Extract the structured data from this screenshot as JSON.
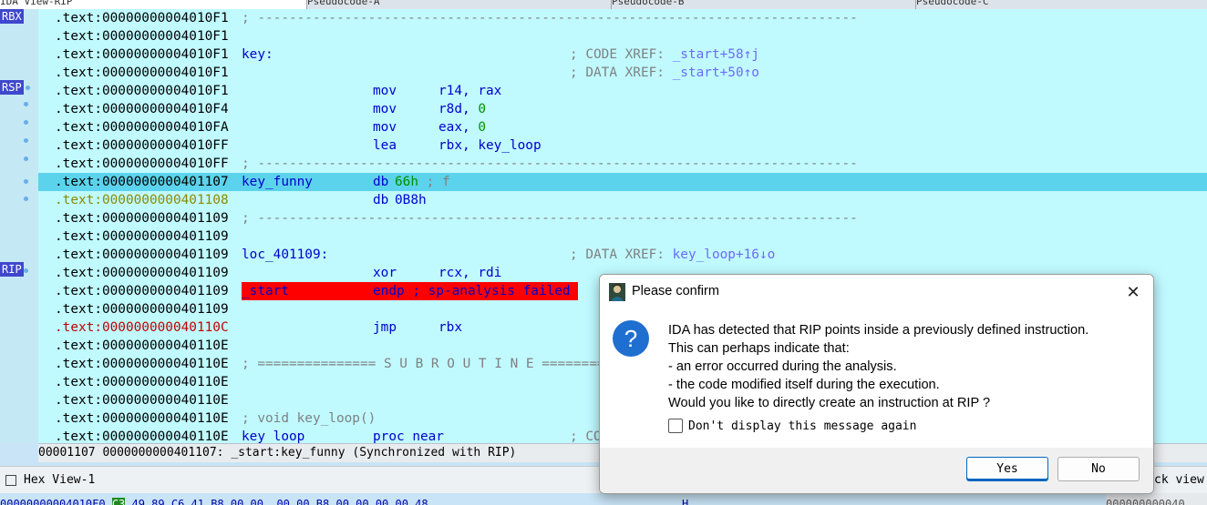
{
  "tabs": [
    {
      "label": "IDA View-RIP",
      "active": true
    },
    {
      "label": "Pseudocode-A",
      "active": false
    },
    {
      "label": "Pseudocode-B",
      "active": false
    },
    {
      "label": "Pseudocode-C",
      "active": false
    }
  ],
  "registers": [
    {
      "name": "RBX"
    },
    {
      "name": "RSP"
    },
    {
      "name": "RIP"
    }
  ],
  "listing": [
    {
      "addr": ".text:00000000004010F1",
      "sep": "; ----------------------------------------------------------------------------"
    },
    {
      "addr": ".text:00000000004010F1"
    },
    {
      "addr": ".text:00000000004010F1",
      "label": "key:",
      "comment": "; CODE XREF: ",
      "xref": "_start+58↑j"
    },
    {
      "addr": ".text:00000000004010F1",
      "comment": "; DATA XREF: ",
      "xref": "_start+50↑o"
    },
    {
      "addr": ".text:00000000004010F1",
      "mnem": "mov",
      "op1": "r14, rax"
    },
    {
      "addr": ".text:00000000004010F4",
      "mnem": "mov",
      "op1": "r8d, ",
      "num": "0"
    },
    {
      "addr": ".text:00000000004010FA",
      "mnem": "mov",
      "op1": "eax, ",
      "num": "0"
    },
    {
      "addr": ".text:00000000004010FF",
      "mnem": "lea",
      "op1": "rbx, key_loop"
    },
    {
      "addr": ".text:00000000004010FF",
      "sep": "; ----------------------------------------------------------------------------"
    },
    {
      "addr": ".text:0000000000401107",
      "label": "key_funny",
      "mnem": "db",
      "dbval": "66h",
      "dbcmt": " ; f"
    },
    {
      "addr": ".text:0000000000401108",
      "mnem": "db",
      "dbplain": "0B8h"
    },
    {
      "addr": ".text:0000000000401109",
      "sep": "; ----------------------------------------------------------------------------"
    },
    {
      "addr": ".text:0000000000401109"
    },
    {
      "addr": ".text:0000000000401109",
      "label": "loc_401109:",
      "comment": "; DATA XREF: ",
      "xref": "key_loop+16↓o"
    },
    {
      "addr": ".text:0000000000401109",
      "mnem": "xor",
      "op1": "rcx, rdi"
    },
    {
      "addr": ".text:0000000000401109",
      "label": "_start",
      "mnem": "endp ; sp-analysis failed"
    },
    {
      "addr": ".text:0000000000401109"
    },
    {
      "addr": ".text:000000000040110C",
      "mnem": "jmp",
      "op1": "rbx"
    },
    {
      "addr": ".text:000000000040110E"
    },
    {
      "addr": ".text:000000000040110E",
      "sep": "; =============== S U B R O U T I N E ======================================="
    },
    {
      "addr": ".text:000000000040110E"
    },
    {
      "addr": ".text:000000000040110E"
    },
    {
      "addr": ".text:000000000040110E",
      "sep": "; void key_loop()"
    },
    {
      "addr": ".text:000000000040110E",
      "label": "key_loop",
      "mnem": "proc near",
      "comment": "; CO"
    }
  ],
  "status_line": "00001107 0000000000401107: _start:key_funny (Synchronized with RIP)",
  "hex_view": {
    "tab_label": "Hex View-1",
    "address": "00000000004010F0",
    "highlight_byte": "C3",
    "bytes": " 49 89 C6 41 B8 00 00  00 00 B8 00 00 00 00 48",
    "ascii": "H",
    "right_pane_label": "ck view",
    "right_addr": "000000000040"
  },
  "dialog": {
    "title": "Please confirm",
    "message_lines": [
      "IDA has detected that RIP points inside a previously defined instruction.",
      "This can perhaps indicate that:",
      "- an error occurred during the analysis.",
      "- the code modified itself during the execution.",
      "Would you like to directly create an instruction at RIP ?"
    ],
    "checkbox_label": "Don't display this message again",
    "checkbox_checked": false,
    "yes_label": "Yes",
    "no_label": "No",
    "icon": "question-icon"
  },
  "colors": {
    "listing_bg": "#c0faff",
    "selection": "#5cd3ec",
    "error_bar": "#ff0000",
    "register_badge": "#3f48cc",
    "accent": "#1f6fd1"
  }
}
